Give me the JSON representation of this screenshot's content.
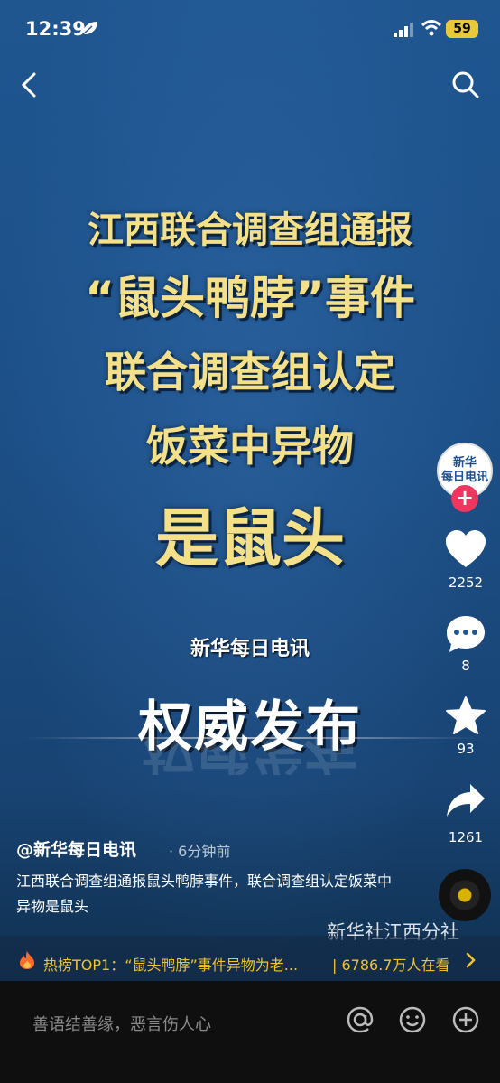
{
  "status_bar": {
    "time": "12:39",
    "battery": "59"
  },
  "headline": {
    "line1": "江西联合调查组通报",
    "line2": "“鼠头鸭脖”事件",
    "line3": "联合调查组认定",
    "line4": "饭菜中异物",
    "line5": "是鼠头"
  },
  "logo_text": "新华每日电讯",
  "release_text": "权威发布",
  "rail": {
    "avatar_text_1": "新华",
    "avatar_text_2": "每日电讯",
    "follow": "+",
    "likes": "2252",
    "comments": "8",
    "favorites": "93",
    "shares": "1261"
  },
  "post": {
    "author": "@新华每日电讯",
    "age": "· 6分钟前",
    "description": "江西联合调查组通报鼠头鸭脖事件，联合调查组认定饭菜中异物是鼠头",
    "watermark": "新华社江西分社"
  },
  "hot": {
    "text": "热榜TOP1：“鼠头鸭脖”事件异物为老...",
    "viewers": "| 6786.7万人在看"
  },
  "bottom": {
    "placeholder": "善语结善缘，恶言伤人心"
  },
  "colors": {
    "headline": "#f5e08a",
    "follow": "#f0355e",
    "hot": "#f2c230"
  },
  "icons": [
    "leaf-icon",
    "signal-icon",
    "wifi-icon",
    "back-icon",
    "search-icon",
    "heart-icon",
    "comment-icon",
    "star-icon",
    "share-icon",
    "fire-icon",
    "chevron-right-icon",
    "at-icon",
    "emoji-icon",
    "plus-icon"
  ]
}
